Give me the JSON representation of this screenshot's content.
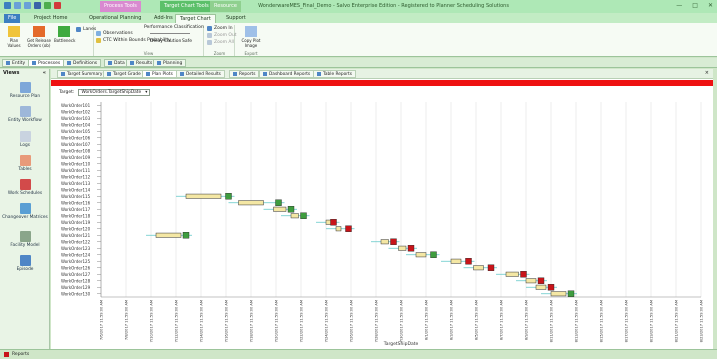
{
  "window": {
    "title": "WonderwareMES_Final_Demo - Salvo Enterprise Edition - Registered to Planner Scheduling Solutions",
    "context_tabs": [
      "Process Tools",
      "Target Chart Tools",
      "Resource"
    ],
    "controls": [
      "—",
      "□",
      "✕"
    ]
  },
  "ribbon": {
    "tabs": [
      "File",
      "Project Home",
      "Operational Planning",
      "Add-Ins",
      "Target Chart",
      "Support"
    ],
    "active_tab": "Target Chart",
    "buttons": {
      "plan_values": "Plan Values",
      "get_release_orders": "Get Release Orders (ob)",
      "bottleneck": "Bottleneck",
      "lanes": "Lanes",
      "observations": "Observations",
      "perf_class": "Performance Classification",
      "ctc": "CTC Within Bounds Probability",
      "delay": "Delay",
      "caution": "Caution",
      "safe": "Safe",
      "zoom_in": "Zoom In",
      "zoom_out": "Zoom Out",
      "zoom_all": "Zoom All",
      "copy_plot": "Copy Plot Image"
    },
    "groups": {
      "view": "View",
      "zoom": "Zoom",
      "export": "Export"
    }
  },
  "doc_tabs": [
    "Entity",
    "Processes",
    "Definitions",
    "Data",
    "Results",
    "Planning"
  ],
  "nav": {
    "title": "Views",
    "items": [
      "Resource Plan",
      "Entity Workflow",
      "Logs",
      "Tables",
      "Work Schedules",
      "Changeover Matrices",
      "Facility Model",
      "Episode"
    ]
  },
  "subtabs": [
    "Target Summary",
    "Target Grade",
    "Plan Plots",
    "Detailed Results",
    "Reports",
    "Dashboard Reports",
    "Table Reports"
  ],
  "active_subtab": "Plan Plots",
  "target": {
    "label": "Target:",
    "value": "WorkOrders.TargetShipDate"
  },
  "status": {
    "text": "Reports"
  },
  "chart_data": {
    "type": "scatter",
    "xlabel": "TargetShipDate",
    "categories": [
      "WorkOrder101",
      "WorkOrder102",
      "WorkOrder103",
      "WorkOrder104",
      "WorkOrder105",
      "WorkOrder106",
      "WorkOrder107",
      "WorkOrder108",
      "WorkOrder109",
      "WorkOrder110",
      "WorkOrder111",
      "WorkOrder112",
      "WorkOrder113",
      "WorkOrder114",
      "WorkOrder115",
      "WorkOrder116",
      "WorkOrder117",
      "WorkOrder118",
      "WorkOrder119",
      "WorkOrder120",
      "WorkOrder121",
      "WorkOrder122",
      "WorkOrder123",
      "WorkOrder124",
      "WorkOrder125",
      "WorkOrder126",
      "WorkOrder127",
      "WorkOrder128",
      "WorkOrder129",
      "WorkOrder130"
    ],
    "xticks": [
      "7/6/2017 11:59:00 AM",
      "7/8/2017 11:59:00 AM",
      "7/10/2017 11:59:00 AM",
      "7/12/2017 11:59:00 AM",
      "7/14/2017 11:59:00 AM",
      "7/16/2017 11:59:00 AM",
      "7/18/2017 11:59:00 AM",
      "7/20/2017 11:59:00 AM",
      "7/22/2017 11:59:00 AM",
      "7/24/2017 11:59:00 AM",
      "7/26/2017 11:59:00 AM",
      "7/28/2017 11:59:00 AM",
      "7/30/2017 11:59:00 AM",
      "8/1/2017 11:59:00 AM",
      "8/3/2017 11:59:00 AM",
      "8/5/2017 11:59:00 AM",
      "8/7/2017 11:59:00 AM",
      "8/9/2017 11:59:00 AM",
      "8/11/2017 11:59:00 AM",
      "8/13/2017 11:59:00 AM",
      "8/15/2017 11:59:00 AM",
      "8/17/2017 11:59:00 AM",
      "8/19/2017 11:59:00 AM",
      "8/21/2017 11:59:00 AM",
      "8/23/2017 11:59:00 AM"
    ],
    "orders": [
      {
        "row": 15,
        "start": 3.4,
        "finish": 4.8,
        "target": 5.1,
        "status": "caution"
      },
      {
        "row": 16,
        "start": 5.5,
        "finish": 6.5,
        "target": 7.1,
        "status": "caution"
      },
      {
        "row": 17,
        "start": 6.9,
        "finish": 7.4,
        "target": 7.6,
        "status": "caution"
      },
      {
        "row": 18,
        "start": 7.6,
        "finish": 7.9,
        "target": 8.1,
        "status": "caution"
      },
      {
        "row": 19,
        "start": 9.0,
        "finish": 9.2,
        "target": 9.3,
        "status": "late"
      },
      {
        "row": 20,
        "start": 9.4,
        "finish": 9.6,
        "target": 9.9,
        "status": "late"
      },
      {
        "row": 21,
        "start": 2.2,
        "finish": 3.2,
        "target": 3.4,
        "status": "caution"
      },
      {
        "row": 22,
        "start": 11.2,
        "finish": 11.5,
        "target": 11.7,
        "status": "late"
      },
      {
        "row": 23,
        "start": 11.9,
        "finish": 12.2,
        "target": 12.4,
        "status": "late"
      },
      {
        "row": 24,
        "start": 12.6,
        "finish": 13.0,
        "target": 13.3,
        "status": "caution"
      },
      {
        "row": 25,
        "start": 14.0,
        "finish": 14.4,
        "target": 14.7,
        "status": "late"
      },
      {
        "row": 26,
        "start": 14.9,
        "finish": 15.3,
        "target": 15.6,
        "status": "late"
      },
      {
        "row": 27,
        "start": 16.2,
        "finish": 16.7,
        "target": 16.9,
        "status": "late"
      },
      {
        "row": 28,
        "start": 17.0,
        "finish": 17.4,
        "target": 17.6,
        "status": "late"
      },
      {
        "row": 29,
        "start": 17.4,
        "finish": 17.8,
        "target": 18.0,
        "status": "late"
      },
      {
        "row": 30,
        "start": 18.0,
        "finish": 18.6,
        "target": 18.8,
        "status": "caution"
      }
    ],
    "colors": {
      "bar": "#f4e7a4",
      "caution": "#3e9d3e",
      "late": "#c8141a",
      "whisker": "#5ec6c6",
      "grid": "#dddddd"
    },
    "grid": true
  }
}
